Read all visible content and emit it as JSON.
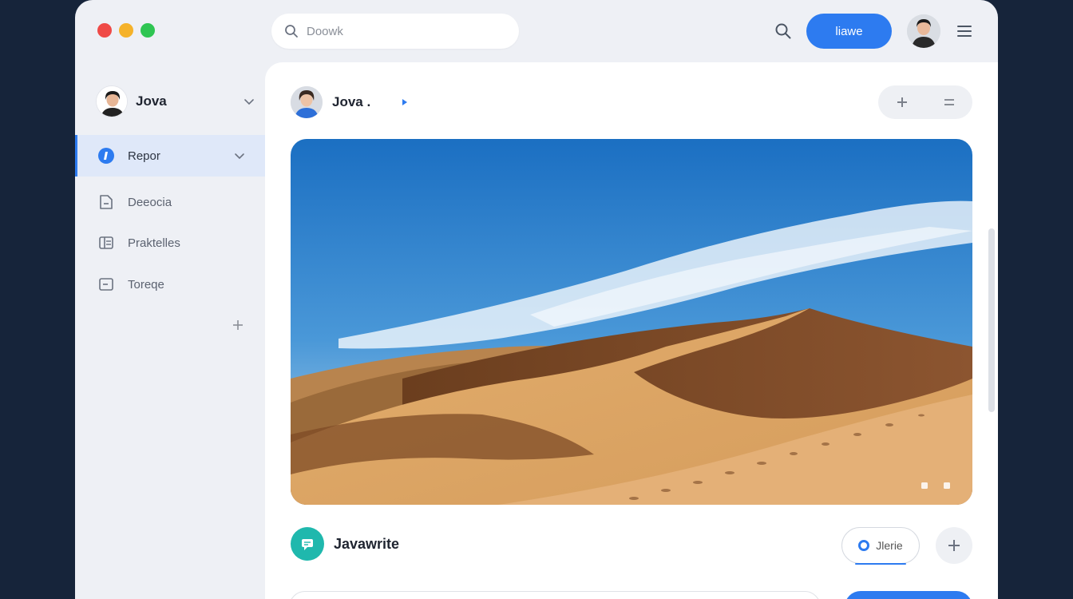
{
  "window": {
    "search_placeholder": "Doowk",
    "primary_button_label": "liawe"
  },
  "sidebar": {
    "profile_name": "Jova",
    "items": [
      {
        "label": "Repor",
        "icon": "info-icon",
        "active": true
      },
      {
        "label": "Deeocia",
        "icon": "document-icon",
        "active": false
      },
      {
        "label": "Praktelles",
        "icon": "grid-icon",
        "active": false
      },
      {
        "label": "Toreqe",
        "icon": "folder-icon",
        "active": false
      }
    ]
  },
  "post": {
    "author": "Jova .",
    "image_subject": "desert-dunes-photo"
  },
  "footer": {
    "title": "Javawrite",
    "outline_button_label": "Jlerie"
  },
  "colors": {
    "accent": "#2d7bf0",
    "teal": "#1fb8ad",
    "background": "#16243a"
  }
}
